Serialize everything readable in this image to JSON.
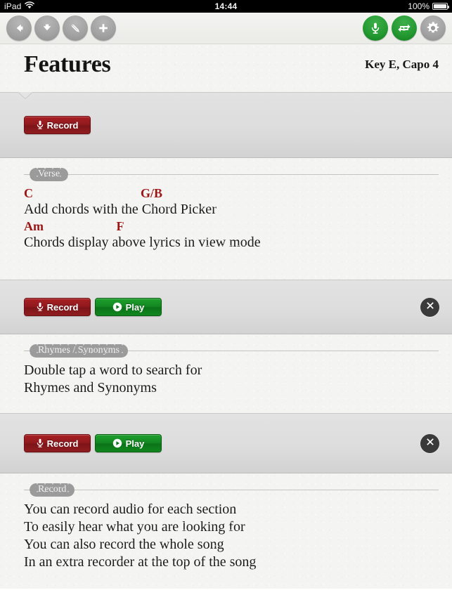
{
  "status_bar": {
    "carrier": "iPad",
    "wifi_icon": "wifi-icon",
    "time": "14:44",
    "battery_percent": "100%",
    "battery_icon": "battery-full-icon"
  },
  "toolbar": {
    "left_buttons": [
      {
        "name": "back-button",
        "icon": "arrow-left-icon",
        "style": "gray"
      },
      {
        "name": "download-button",
        "icon": "arrow-down-icon",
        "style": "gray"
      },
      {
        "name": "edit-button",
        "icon": "pencil-icon",
        "style": "gray"
      },
      {
        "name": "add-button",
        "icon": "plus-icon",
        "style": "gray"
      }
    ],
    "right_buttons": [
      {
        "name": "record-song-button",
        "icon": "microphone-icon",
        "style": "green"
      },
      {
        "name": "loop-button",
        "icon": "repeat-one-icon",
        "style": "green"
      },
      {
        "name": "settings-button",
        "icon": "gear-icon",
        "style": "gray"
      }
    ]
  },
  "header": {
    "title": "Features",
    "key_info": "Key E, Capo 4"
  },
  "colors": {
    "record_red": "#911a1e",
    "play_green": "#148a22",
    "accent_green": "#269b33",
    "chord_red": "#9c1515",
    "band_gray": "#dddddd",
    "paper": "#f4f4f2"
  },
  "sections": [
    {
      "id": "intro-band",
      "type": "band",
      "has_notch": true,
      "buttons": [
        {
          "name": "record-button",
          "label": "Record",
          "icon": "microphone-icon",
          "style": "red"
        }
      ],
      "has_delete": false
    },
    {
      "id": "verse-section",
      "type": "lyrics",
      "label": "Verse",
      "lines": [
        {
          "chords": "C                                  G/B",
          "lyric": "Add chords with the Chord Picker"
        },
        {
          "chords": "Am                       F",
          "lyric": "Chords display above lyrics in view mode"
        }
      ]
    },
    {
      "id": "verse-band",
      "type": "band",
      "has_notch": false,
      "buttons": [
        {
          "name": "record-button",
          "label": "Record",
          "icon": "microphone-icon",
          "style": "red"
        },
        {
          "name": "play-button",
          "label": "Play",
          "icon": "play-icon",
          "style": "green"
        }
      ],
      "has_delete": true,
      "delete_label": "delete-recording-button"
    },
    {
      "id": "rhymes-section",
      "type": "lyrics",
      "label": "Rhymes / Synonyms",
      "lines": [
        {
          "chords": "",
          "lyric": "Double tap a word to search for"
        },
        {
          "chords": "",
          "lyric": "Rhymes and Synonyms"
        }
      ]
    },
    {
      "id": "rhymes-band",
      "type": "band",
      "has_notch": false,
      "buttons": [
        {
          "name": "record-button",
          "label": "Record",
          "icon": "microphone-icon",
          "style": "red"
        },
        {
          "name": "play-button",
          "label": "Play",
          "icon": "play-icon",
          "style": "green"
        }
      ],
      "has_delete": true,
      "delete_label": "delete-recording-button"
    },
    {
      "id": "record-section",
      "type": "lyrics",
      "label": "Record",
      "lines": [
        {
          "chords": "",
          "lyric": "You can record audio for each section"
        },
        {
          "chords": "",
          "lyric": "To easily hear what you are looking for"
        },
        {
          "chords": "",
          "lyric": "You can also record the whole song"
        },
        {
          "chords": "",
          "lyric": "In an extra recorder at the top of the song"
        }
      ]
    }
  ]
}
